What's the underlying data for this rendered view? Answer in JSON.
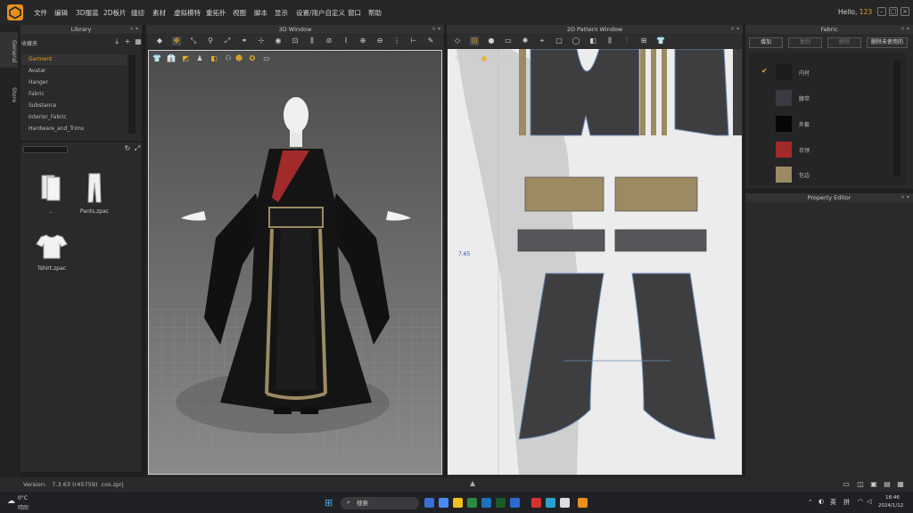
{
  "menu": [
    "文件",
    "编辑",
    "3D服装",
    "2D板片",
    "缝纫",
    "素材",
    "虚拟模特",
    "重拓扑",
    "视图",
    "脚本",
    "显示",
    "设置/用户自定义",
    "窗口",
    "帮助"
  ],
  "greeting": {
    "prefix": "Hello,",
    "user": "123"
  },
  "side_tabs": {
    "general": "General",
    "store": "Store"
  },
  "library": {
    "title": "Library",
    "path": "收藏夹",
    "items": [
      "Garment",
      "Avatar",
      "Hanger",
      "Fabric",
      "Substance",
      "Interior_Fabric",
      "Hardware_and_Trims"
    ],
    "files": [
      "..",
      "Pants.zpac",
      "Tshirt.zpac"
    ]
  },
  "window3d": {
    "title": "3D Window"
  },
  "window2d": {
    "title": "2D Pattern Window",
    "measure": "7.65"
  },
  "fabric": {
    "title": "Fabric",
    "buttons": [
      "增加",
      "复制",
      "删除",
      "删除未使用的"
    ],
    "items": [
      {
        "name": "内衬",
        "color": "#1c1c1c",
        "checked": true
      },
      {
        "name": "腰带",
        "color": "#3a3a40",
        "checked": false
      },
      {
        "name": "外套",
        "color": "#060606",
        "checked": false
      },
      {
        "name": "衣领",
        "color": "#a32a2a",
        "checked": false
      },
      {
        "name": "包边",
        "color": "#9c8a62",
        "checked": false
      }
    ]
  },
  "property": {
    "title": "Property Editor"
  },
  "status": {
    "version_label": "Version:",
    "version": "7.3.63 (r45759)",
    "file": "cos.zprj"
  },
  "taskbar": {
    "weather_temp": "0°C",
    "weather_text": "晴朗",
    "search": "搜索",
    "ime1": "英",
    "ime2": "拼",
    "time": "18:46",
    "date": "2024/1/12"
  }
}
